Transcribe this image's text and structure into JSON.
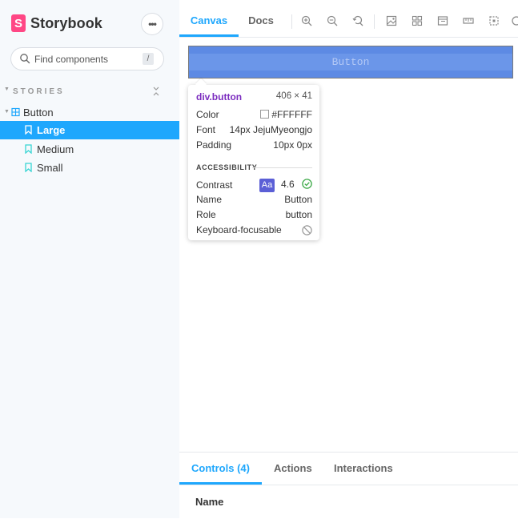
{
  "brand": {
    "logo_letter": "S",
    "name": "Storybook",
    "menu_label": "•••"
  },
  "search": {
    "placeholder": "Find components",
    "shortcut": "/"
  },
  "sidebar": {
    "section_label": "STORIES",
    "tree": [
      {
        "label": "Button",
        "type": "component",
        "icon": "component-icon"
      },
      {
        "label": "Large",
        "type": "story",
        "selected": true,
        "icon": "bookmark-icon"
      },
      {
        "label": "Medium",
        "type": "story",
        "icon": "bookmark-icon"
      },
      {
        "label": "Small",
        "type": "story",
        "icon": "bookmark-icon"
      }
    ]
  },
  "toolbar": {
    "tabs": [
      {
        "label": "Canvas",
        "active": true
      },
      {
        "label": "Docs"
      }
    ],
    "tools": [
      "zoom-in-icon",
      "zoom-out-icon",
      "zoom-reset-icon",
      "background-icon",
      "grid-icon",
      "viewport-icon",
      "measure-icon",
      "outline-icon",
      "more-icon"
    ]
  },
  "preview": {
    "button_text": "Button"
  },
  "inspector": {
    "element": "div",
    "element_class": ".button",
    "dimensions": "406 × 41",
    "color_label": "Color",
    "color_value": "#FFFFFF",
    "font_label": "Font",
    "font_value": "14px JejuMyeongjo",
    "padding_label": "Padding",
    "padding_value": "10px 0px",
    "accessibility_title": "ACCESSIBILITY",
    "contrast_label": "Contrast",
    "contrast_badge": "Aa",
    "contrast_value": "4.6",
    "name_label": "Name",
    "name_value": "Button",
    "role_label": "Role",
    "role_value": "button",
    "keyboard_label": "Keyboard-focusable"
  },
  "addons": {
    "tabs": [
      {
        "label": "Controls (4)",
        "active": true
      },
      {
        "label": "Actions"
      },
      {
        "label": "Interactions"
      }
    ],
    "table_header_name": "Name"
  },
  "colors": {
    "accent": "#1ea7fd",
    "brand": "#ff4785",
    "selected_bg": "#1ea7fd",
    "preview_button": "#5d8ae4",
    "contrast_badge": "#5b5fd6",
    "pass": "#3aa845"
  }
}
